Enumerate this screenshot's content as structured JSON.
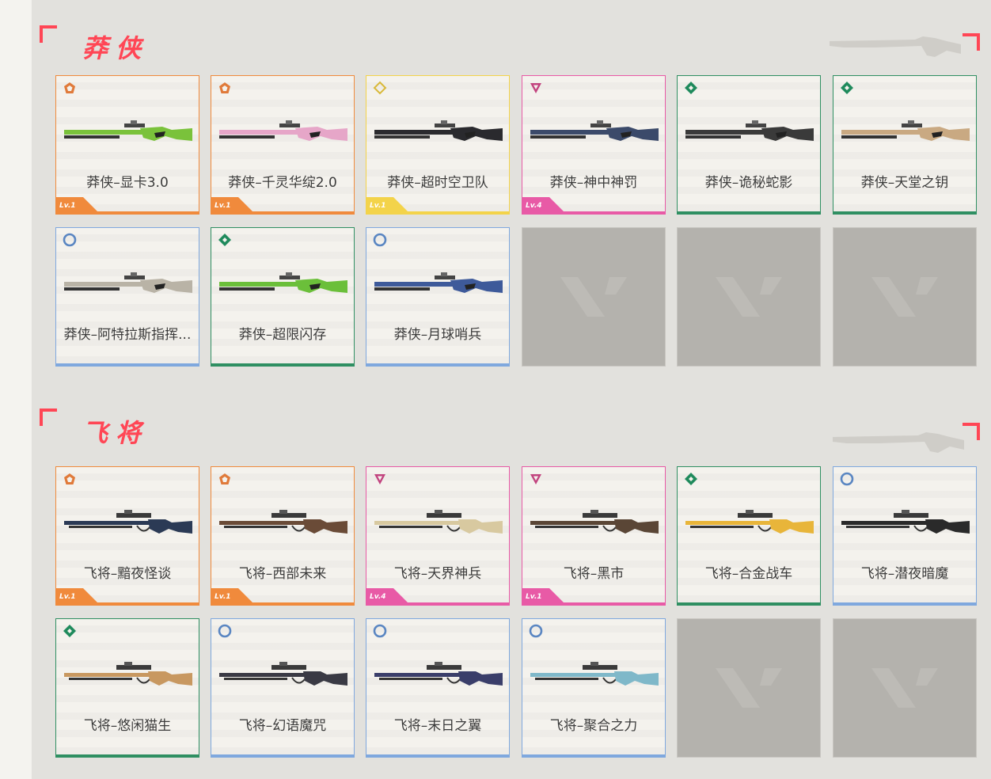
{
  "sections": [
    {
      "title": "莽侠",
      "items": [
        {
          "label": "莽侠–显卡3.0",
          "tier": "exclusive",
          "level": "Lv.1",
          "accent": "#f08a3c",
          "gun": "#7ac23b"
        },
        {
          "label": "莽侠–千灵华绽2.0",
          "tier": "exclusive",
          "level": "Lv.1",
          "accent": "#f08a3c",
          "gun": "#e6a6c8"
        },
        {
          "label": "莽侠–超时空卫队",
          "tier": "ultra",
          "level": "Lv.1",
          "accent": "#f3d34a",
          "gun": "#2a2a2e"
        },
        {
          "label": "莽侠–神中神罚",
          "tier": "premium",
          "level": "Lv.4",
          "accent": "#e85aa6",
          "gun": "#3b4a6a"
        },
        {
          "label": "莽侠–诡秘蛇影",
          "tier": "deluxe",
          "level": "",
          "accent": "#2f8f62",
          "gun": "#3a3a3a"
        },
        {
          "label": "莽侠–天堂之钥",
          "tier": "deluxe",
          "level": "",
          "accent": "#2f8f62",
          "gun": "#c9a982"
        },
        {
          "label": "莽侠–阿特拉斯指挥...",
          "tier": "select",
          "level": "",
          "accent": "#7fa8de",
          "gun": "#b9b3a6"
        },
        {
          "label": "莽侠–超限闪存",
          "tier": "deluxe",
          "level": "",
          "accent": "#2f8f62",
          "gun": "#6bbf3a"
        },
        {
          "label": "莽侠–月球哨兵",
          "tier": "select",
          "level": "",
          "accent": "#7fa8de",
          "gun": "#3e5a9a"
        }
      ]
    },
    {
      "title": "飞将",
      "items": [
        {
          "label": "飞将–黯夜怪谈",
          "tier": "exclusive",
          "level": "Lv.1",
          "accent": "#f08a3c",
          "gun": "#2b3a55"
        },
        {
          "label": "飞将–西部未来",
          "tier": "exclusive",
          "level": "Lv.1",
          "accent": "#f08a3c",
          "gun": "#6a4b37"
        },
        {
          "label": "飞将–天界神兵",
          "tier": "premium",
          "level": "Lv.4",
          "accent": "#e85aa6",
          "gun": "#d8c9a0"
        },
        {
          "label": "飞将–黑市",
          "tier": "premium",
          "level": "Lv.1",
          "accent": "#e85aa6",
          "gun": "#5a4636"
        },
        {
          "label": "飞将–合金战车",
          "tier": "deluxe",
          "level": "",
          "accent": "#2f8f62",
          "gun": "#e8b53a"
        },
        {
          "label": "飞将–潜夜暗魔",
          "tier": "select",
          "level": "",
          "accent": "#7fa8de",
          "gun": "#2a2a2a"
        },
        {
          "label": "飞将–悠闲猫生",
          "tier": "deluxe",
          "level": "",
          "accent": "#2f8f62",
          "gun": "#c89860"
        },
        {
          "label": "飞将–幻语魔咒",
          "tier": "select",
          "level": "",
          "accent": "#7fa8de",
          "gun": "#3a3a44"
        },
        {
          "label": "飞将–末日之翼",
          "tier": "select",
          "level": "",
          "accent": "#7fa8de",
          "gun": "#3a3e6a"
        },
        {
          "label": "飞将–聚合之力",
          "tier": "select",
          "level": "",
          "accent": "#7fa8de",
          "gun": "#7fb8c9"
        }
      ]
    }
  ],
  "tier_icons": {
    "exclusive": {
      "name": "exclusive-tier-icon",
      "color": "#e07a3a"
    },
    "ultra": {
      "name": "ultra-tier-icon",
      "color": "#d9b93a"
    },
    "premium": {
      "name": "premium-tier-icon",
      "color": "#c2447f"
    },
    "deluxe": {
      "name": "deluxe-tier-icon",
      "color": "#1f8a5c"
    },
    "select": {
      "name": "select-tier-icon",
      "color": "#5a86c2"
    }
  },
  "colors": {
    "brand_red": "#ff4655",
    "empty_slot": "#b4b2ad"
  }
}
